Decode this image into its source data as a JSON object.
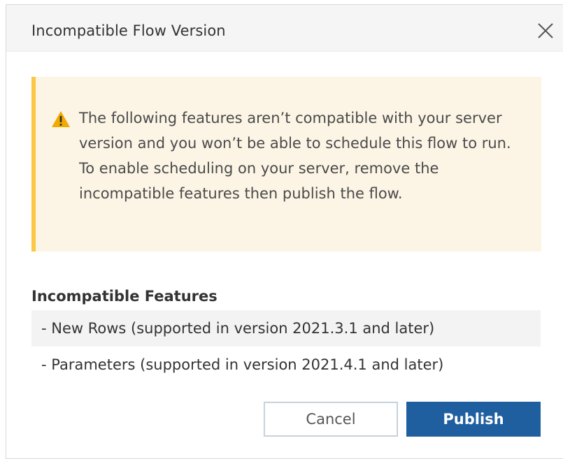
{
  "dialog": {
    "title": "Incompatible Flow Version",
    "close_icon": "close-icon"
  },
  "warning": {
    "icon": "warning-icon",
    "message": "The following features aren’t compatible with your server version and you won’t be able to schedule this flow to run. To enable scheduling on your server, remove the incompatible features then publish the flow."
  },
  "features": {
    "heading": "Incompatible Features",
    "items": [
      "- New Rows (supported in version 2021.3.1 and later)",
      "- Parameters (supported in version 2021.4.1 and later)"
    ]
  },
  "buttons": {
    "cancel": "Cancel",
    "publish": "Publish"
  },
  "colors": {
    "warning_bg": "#fcf5e6",
    "warning_accent": "#fcc744",
    "primary": "#1f5fa0"
  }
}
